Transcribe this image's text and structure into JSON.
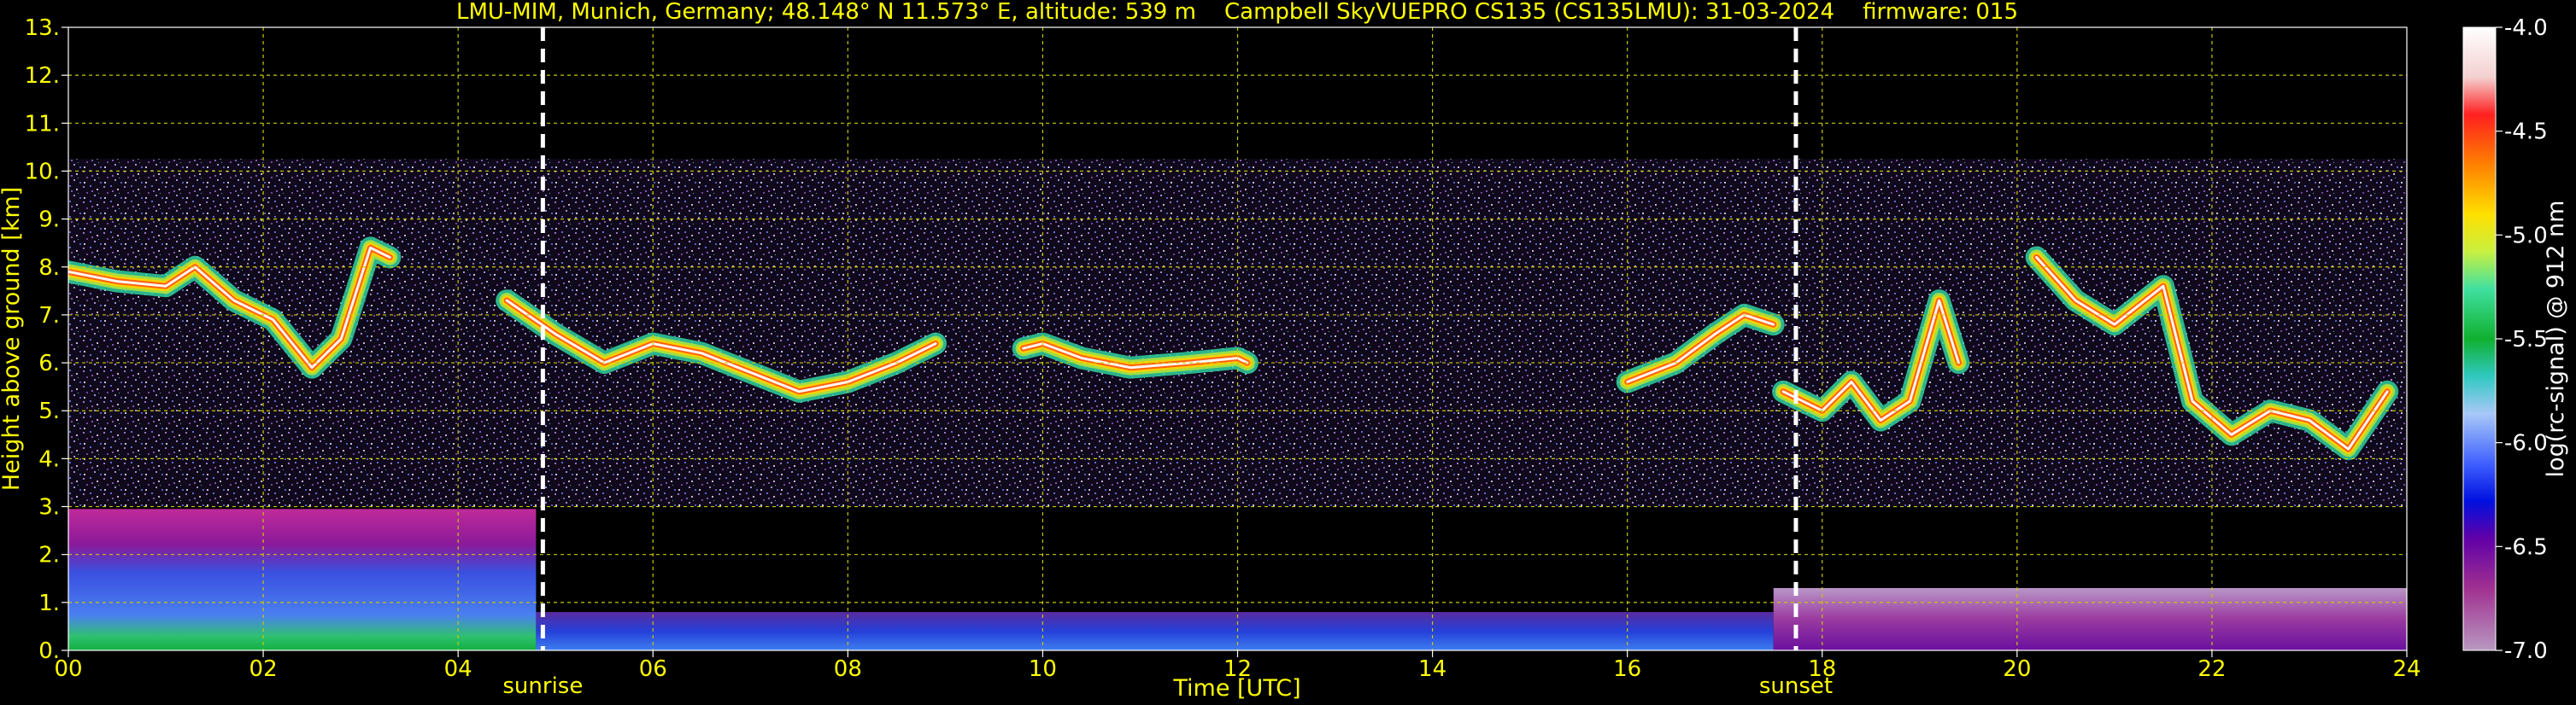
{
  "chart_data": [
    {
      "type": "heatmap",
      "title": "LMU-MIM, Munich, Germany; 48.148° N 11.573° E, altitude: 539 m    Campbell SkyVUEPRO CS135 (CS135LMU): 31-03-2024    firmware: 015",
      "xlabel": "Time [UTC]",
      "ylabel": "Height above ground [km]",
      "xlim": [
        0,
        24
      ],
      "ylim": [
        0,
        13
      ],
      "x_ticks": [
        "00",
        "02",
        "04",
        "06",
        "08",
        "10",
        "12",
        "14",
        "16",
        "18",
        "20",
        "22",
        "24"
      ],
      "y_ticks": [
        "0.",
        "1.",
        "2.",
        "3.",
        "4.",
        "5.",
        "6.",
        "7.",
        "8.",
        "9.",
        "10.",
        "11.",
        "12.",
        "13."
      ],
      "grid": true,
      "events": [
        {
          "label": "sunrise",
          "time_utc": 4.87
        },
        {
          "label": "sunset",
          "time_utc": 17.73
        }
      ],
      "colorbar": {
        "label": "log(rc-signal) @ 912 nm",
        "range": [
          -7.0,
          -4.0
        ],
        "ticks": [
          "-4.0",
          "-4.5",
          "-5.0",
          "-5.5",
          "-6.0",
          "-6.5",
          "-7.0"
        ]
      },
      "layers": [
        {
          "feature": "noise-field",
          "start": 0.0,
          "end": 24.0,
          "bottom": 3.0,
          "top": 10.25
        },
        {
          "feature": "boundary-layer",
          "start": 0.0,
          "end": 4.8,
          "bottom": 0.0,
          "top": 2.95
        },
        {
          "feature": "residual-layer",
          "start": 4.8,
          "end": 17.5,
          "bottom": 0.0,
          "top": 0.8
        },
        {
          "feature": "night-layer",
          "start": 17.5,
          "end": 24.0,
          "bottom": 0.0,
          "top": 1.3
        }
      ],
      "cloud_tracks": [
        {
          "name": "cirrus-early",
          "t": [
            0.0,
            0.5,
            1.0,
            1.3,
            1.7,
            2.1,
            2.5,
            2.8,
            3.1,
            3.3
          ],
          "h": [
            7.9,
            7.7,
            7.6,
            8.0,
            7.3,
            6.9,
            5.9,
            6.5,
            8.4,
            8.2
          ]
        },
        {
          "name": "cloud-morning",
          "t": [
            4.5,
            5.0,
            5.5,
            6.0,
            6.5,
            7.0,
            7.5,
            8.0,
            8.5,
            8.9
          ],
          "h": [
            7.3,
            6.6,
            6.0,
            6.4,
            6.2,
            5.8,
            5.4,
            5.6,
            6.0,
            6.4
          ]
        },
        {
          "name": "cloud-midday",
          "t": [
            9.8,
            10.0,
            10.4,
            10.9,
            11.5,
            12.0,
            12.1
          ],
          "h": [
            6.3,
            6.4,
            6.1,
            5.9,
            6.0,
            6.1,
            6.0
          ]
        },
        {
          "name": "cloud-afternoon",
          "t": [
            16.0,
            16.5,
            16.9,
            17.2,
            17.5
          ],
          "h": [
            5.6,
            6.0,
            6.6,
            7.0,
            6.8
          ]
        },
        {
          "name": "cloud-evening",
          "t": [
            17.6,
            18.0,
            18.3,
            18.6,
            18.9,
            19.2,
            19.4
          ],
          "h": [
            5.4,
            5.0,
            5.6,
            4.8,
            5.2,
            7.3,
            6.0
          ]
        },
        {
          "name": "cloud-night",
          "t": [
            20.2,
            20.6,
            21.0,
            21.5,
            21.8,
            22.2,
            22.6,
            23.0,
            23.4,
            23.8
          ],
          "h": [
            8.2,
            7.3,
            6.8,
            7.6,
            5.2,
            4.5,
            5.0,
            4.8,
            4.2,
            5.4
          ]
        }
      ]
    }
  ]
}
